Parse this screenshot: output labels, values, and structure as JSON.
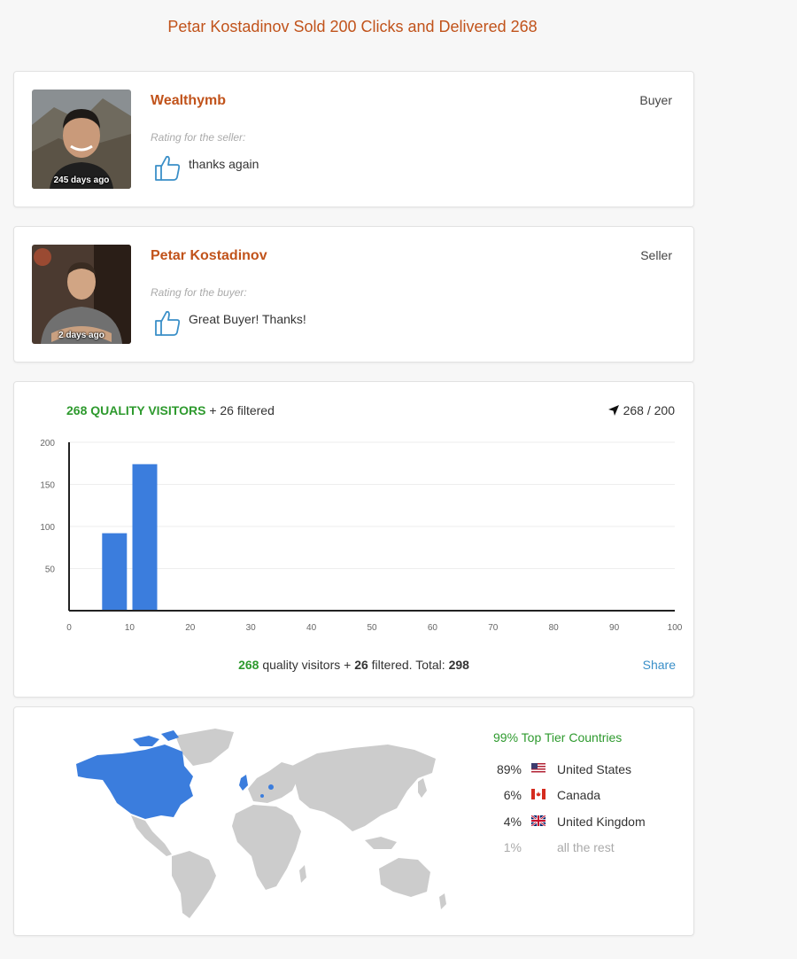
{
  "page": {
    "title": "Petar Kostadinov Sold 200 Clicks and Delivered 268"
  },
  "reviews": [
    {
      "name": "Wealthymb",
      "role": "Buyer",
      "rating_label": "Rating for the seller:",
      "comment": "thanks again",
      "time_ago": "245 days ago"
    },
    {
      "name": "Petar Kostadinov",
      "role": "Seller",
      "rating_label": "Rating for the buyer:",
      "comment": "Great Buyer! Thanks!",
      "time_ago": "2 days ago"
    }
  ],
  "stats": {
    "quality_heading": "268 QUALITY VISITORS",
    "filtered_heading": "+ 26 filtered",
    "ratio": "268 / 200",
    "summary": {
      "quality_count": "268",
      "quality_text": "quality visitors +",
      "filtered_count": "26",
      "filtered_text": "filtered. Total:",
      "total": "298"
    },
    "share_label": "Share"
  },
  "chart_data": {
    "type": "bar",
    "x": [
      7.5,
      12.5
    ],
    "values": [
      92,
      174
    ],
    "xlim": [
      0,
      100
    ],
    "ylim": [
      0,
      200
    ],
    "xticks": [
      0,
      10,
      20,
      30,
      40,
      50,
      60,
      70,
      80,
      90,
      100
    ],
    "yticks": [
      50,
      100,
      150,
      200
    ],
    "bar_color": "#3b7ddd",
    "grid": true
  },
  "geo": {
    "top_tier_label": "99% Top Tier Countries",
    "highlight_color": "#3b7ddd",
    "base_color": "#cccccc",
    "countries": [
      {
        "pct": "89%",
        "name": "United States",
        "flag": "us-flag-icon"
      },
      {
        "pct": "6%",
        "name": "Canada",
        "flag": "ca-flag-icon"
      },
      {
        "pct": "4%",
        "name": "United Kingdom",
        "flag": "uk-flag-icon"
      }
    ],
    "rest": {
      "pct": "1%",
      "name": "all the rest"
    }
  }
}
